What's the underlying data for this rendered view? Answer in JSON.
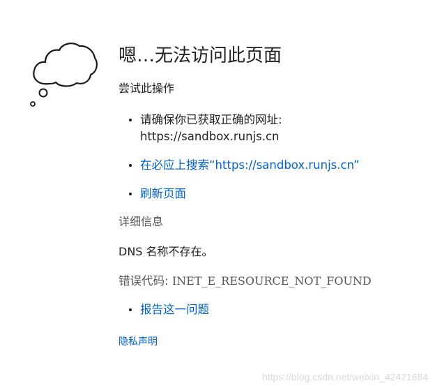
{
  "error_page": {
    "icon": "thought-cloud-icon",
    "title": "嗯…无法访问此页面",
    "subtitle": "尝试此操作",
    "tips": [
      {
        "line1": "请确保你已获取正确的网址:",
        "line2": "https://sandbox.runjs.cn"
      },
      {
        "link": "在必应上搜索“https://sandbox.runjs.cn”"
      },
      {
        "link": "刷新页面"
      }
    ],
    "details_label": "详细信息",
    "dns_message": "DNS 名称不存在。",
    "error_code_label": "错误代码:",
    "error_code": "INET_E_RESOURCE_NOT_FOUND",
    "report_link": "报告这一问题",
    "privacy_link": "隐私声明"
  },
  "watermark": "https://blog.csdn.net/weixin_42421684",
  "colors": {
    "link": "#0062c9",
    "text": "#1a1a1a",
    "muted": "#555555"
  }
}
